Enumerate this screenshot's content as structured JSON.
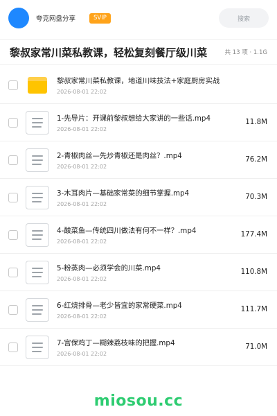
{
  "topbar": {
    "title": "夸克网盘分享",
    "badge": "SVIP",
    "search_placeholder": "搜索"
  },
  "folder": {
    "title": "黎叔家常川菜私教课，轻松复刻餐厅级川菜",
    "meta": "共 13 项 · 1.1G"
  },
  "items": [
    {
      "type": "folder",
      "name": "黎叔家常川菜私教课，地道川味技法+家庭厨房实战",
      "date": "2026-08-01 22:02",
      "size": ""
    },
    {
      "type": "file",
      "name": "1-先导片：开课前黎叔想给大家讲的一些话.mp4",
      "date": "2026-08-01 22:02",
      "size": "11.8M"
    },
    {
      "type": "file",
      "name": "2-青椒肉丝—先炒青椒还是肉丝？.mp4",
      "date": "2026-08-01 22:02",
      "size": "76.2M"
    },
    {
      "type": "file",
      "name": "3-木耳肉片—基础家常菜的细节掌握.mp4",
      "date": "2026-08-01 22:02",
      "size": "70.3M"
    },
    {
      "type": "file",
      "name": "4-酸菜鱼—传统四川做法有何不一样？.mp4",
      "date": "2026-08-01 22:02",
      "size": "177.4M"
    },
    {
      "type": "file",
      "name": "5-粉蒸肉—必须学会的川菜.mp4",
      "date": "2026-08-01 22:02",
      "size": "110.8M"
    },
    {
      "type": "file",
      "name": "6-红烧排骨—老少皆宜的家常硬菜.mp4",
      "date": "2026-08-01 22:02",
      "size": "111.7M"
    },
    {
      "type": "file",
      "name": "7-宫保鸡丁—糊辣荔枝味的把握.mp4",
      "date": "2026-08-01 22:02",
      "size": "71.0M"
    }
  ],
  "watermark": "miosou.cc",
  "colors": {
    "avatar": "#1e88ff",
    "badge": "#ffa31a",
    "folder_icon": "#ffc400",
    "watermark": "#2ecc71"
  }
}
